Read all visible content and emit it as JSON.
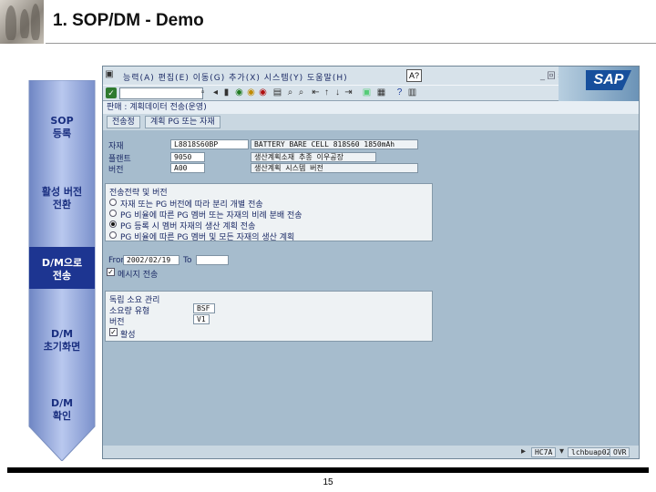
{
  "slide": {
    "title": "1. SOP/DM - Demo",
    "page_number": "15"
  },
  "process_steps": [
    {
      "label": "SOP\n등록",
      "active": false
    },
    {
      "label": "활성 버전\n전환",
      "active": false
    },
    {
      "label": "D/M으로\n전송",
      "active": true
    },
    {
      "label": "D/M\n초기화면",
      "active": false
    },
    {
      "label": "D/M\n확인",
      "active": false
    }
  ],
  "sap": {
    "menubar": {
      "system_icon": "doc-icon",
      "menus": "능력(A)  편집(E)  이동(G)  추가(X)  시스템(Y)  도움말(H)",
      "session_controls": "_ 回 ×"
    },
    "toolbar": {
      "command_value": ""
    },
    "screen_title": "판매 : 계획데이터 전송(운영)",
    "app_toolbar": {
      "buttons": [
        "전송정",
        "계획 PG 또는 자재"
      ]
    },
    "header_fields": [
      {
        "label": "자재",
        "value": "L8818S60BP",
        "desc": "BATTERY BARE CELL 818S60 1850mAh"
      },
      {
        "label": "플랜트",
        "value": "9050",
        "desc": "생산계획소재 추종 이우공장"
      },
      {
        "label": "버전",
        "value": "A00",
        "desc": "생산계획 시스템 버전"
      }
    ],
    "transfer_group": {
      "title": "전송전략 및 버전",
      "options": [
        {
          "label": "자재 또는 PG 버전에 따라 분리 개별 전송",
          "selected": false
        },
        {
          "label": "PG 비율에 따른 PG 멤버 또는 자재의 비례 분배 전송",
          "selected": false
        },
        {
          "label": "PG 등록 시 멤버 자재의 생산 계획 전송",
          "selected": true
        },
        {
          "label": "PG 비율에 따른 PG 멤버 및 모든 자재의 생산 계획",
          "selected": false
        }
      ]
    },
    "period": {
      "label": "From",
      "from_value": "2002/02/19",
      "to_label": "To",
      "to_value": ""
    },
    "invisible_check": {
      "label": "메시지 전송",
      "checked": true
    },
    "independent_group": {
      "title": "독립 소요 관리",
      "fields": [
        {
          "label": "소요량 유형",
          "value": "BSF"
        },
        {
          "label": "버전",
          "value": "V1"
        }
      ],
      "active_check": {
        "label": "활성",
        "checked": true
      }
    },
    "status_bar": {
      "system": "HC7A",
      "server": "lchbuap02",
      "mode": "OVR"
    }
  },
  "colors": {
    "sap_background": "#a6bccd",
    "arrow_fill": "#8fa6d8",
    "arrow_active": "#1d3591"
  }
}
